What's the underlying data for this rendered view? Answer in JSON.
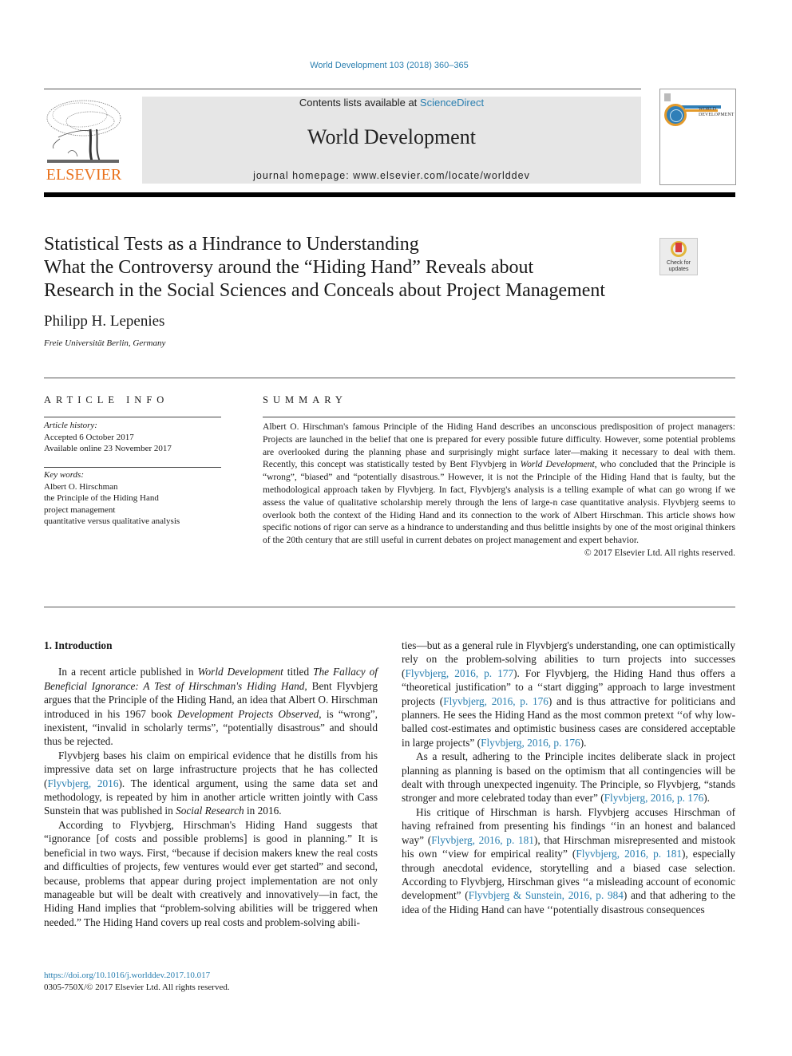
{
  "journal_reference": "World Development 103 (2018) 360–365",
  "masthead": {
    "contents_prefix": "Contents lists available at ",
    "contents_link": "ScienceDirect",
    "journal_title": "World Development",
    "homepage": "journal homepage: www.elsevier.com/locate/worlddev",
    "publisher_logo_text": "ELSEVIER",
    "cover_title_line1": "WORLD",
    "cover_title_line2": "DEVELOPMENT"
  },
  "colors": {
    "link": "#2a7fb0",
    "elsevier_orange": "#e9711c",
    "masthead_bg": "#e6e6e6"
  },
  "article": {
    "title_lines": [
      "Statistical Tests as a Hindrance to Understanding",
      "What the Controversy around the “Hiding Hand” Reveals about",
      "Research in the Social Sciences and Conceals about Project Management"
    ],
    "check_updates_label_1": "Check for",
    "check_updates_label_2": "updates",
    "author": "Philipp H. Lepenies",
    "affiliation": "Freie Universität Berlin, Germany"
  },
  "article_info": {
    "heading": "ARTICLE INFO",
    "history_label": "Article history:",
    "accepted": "Accepted 6 October 2017",
    "available_online": "Available online 23 November 2017",
    "keywords_label": "Key words:",
    "keywords": [
      "Albert O. Hirschman",
      "the Principle of the Hiding Hand",
      "project management",
      "quantitative versus qualitative analysis"
    ]
  },
  "summary": {
    "heading": "SUMMARY",
    "text_part1": "Albert O. Hirschman's famous Principle of the Hiding Hand describes an unconscious predisposition of project managers: Projects are launched in the belief that one is prepared for every possible future difficulty. However, some potential problems are overlooked during the planning phase and surprisingly might surface later—making it necessary to deal with them. Recently, this concept was statistically tested by Bent Flyvbjerg in ",
    "text_italic": "World Development",
    "text_part2": ", who concluded that the Principle is “wrong”, “biased” and “potentially disastrous.” However, it is not the Principle of the Hiding Hand that is faulty, but the methodological approach taken by Flyvbjerg. In fact, Flyvbjerg's analysis is a telling example of what can go wrong if we assess the value of qualitative scholarship merely through the lens of large-n case quantitative analysis. Flyvbjerg seems to overlook both the context of the Hiding Hand and its connection to the work of Albert Hirschman. This article shows how specific notions of rigor can serve as a hindrance to understanding and thus belittle insights by one of the most original thinkers of the 20th century that are still useful in current debates on project management and expert behavior.",
    "copyright": "© 2017 Elsevier Ltd. All rights reserved."
  },
  "body": {
    "section_heading": "1. Introduction",
    "p1": {
      "a": "In a recent article published in ",
      "b_italic": "World Development",
      "c": " titled ",
      "d_italic": "The Fallacy of Beneficial Ignorance: A Test of Hirschman's Hiding Hand,",
      "e": " Bent Flyvbjerg argues that the Principle of the Hiding Hand, an idea that Albert O. Hirschman introduced in his 1967 book ",
      "f_italic": "Development Projects Observed",
      "g": ", is “wrong”, inexistent, “invalid in scholarly terms”, “potentially disastrous” and should thus be rejected."
    },
    "p2": {
      "a": "Flyvbjerg bases his claim on empirical evidence that he distills from his impressive data set on large infrastructure projects that he has collected (",
      "cite1": "Flyvbjerg, 2016",
      "b": "). The identical argument, using the same data set and methodology, is repeated by him in another article written jointly with Cass Sunstein that was published in ",
      "c_italic": "Social Research",
      "d": " in 2016."
    },
    "p3": {
      "a": "According to Flyvbjerg, Hirschman's Hiding Hand suggests that “ignorance [of costs and possible problems] is good in planning.” It is beneficial in two ways. First, “because if decision makers knew the real costs and difficulties of projects, few ventures would ever get started” and second, because, problems that appear during project implementation are not only manageable but will be dealt with creatively and innovatively—in fact, the Hiding Hand implies that “problem-solving abilities will be triggered when needed.” The Hiding Hand covers up real costs and problem-solving abilities—but as a general rule in Flyvbjerg's understanding, one can optimistically rely on the problem-solving abilities to turn projects into successes (",
      "cite1": "Flyvbjerg, 2016, p. 177",
      "b": "). For Flyvbjerg, the Hiding Hand thus offers a “theoretical justification” to a ‘‘start digging” approach to large investment projects (",
      "cite2": "Flyvbjerg, 2016, p. 176",
      "c": ") and is thus attractive for politicians and planners. He sees the Hiding Hand as the most common pretext ‘‘of why low-balled cost-estimates and optimistic business cases are considered acceptable in large projects” (",
      "cite3": "Flyvbjerg, 2016, p. 176",
      "d": ")."
    },
    "p4": {
      "a": "As a result, adhering to the Principle incites deliberate slack in project planning as planning is based on the optimism that all contingencies will be dealt with through unexpected ingenuity. The Principle, so Flyvbjerg, “stands stronger and more celebrated today than ever” (",
      "cite1": "Flyvbjerg, 2016, p. 176",
      "b": ")."
    },
    "p5": {
      "a": "His critique of Hirschman is harsh. Flyvbjerg accuses Hirschman of having refrained from presenting his findings ‘‘in an honest and balanced way” (",
      "cite1": "Flyvbjerg, 2016, p. 181",
      "b": "), that Hirschman misrepresented and mistook his own ‘‘view for empirical reality” (",
      "cite2": "Flyvbjerg, 2016, p. 181",
      "c": "), especially through anecdotal evidence, storytelling and a biased case selection. According to Flyvbjerg, Hirschman gives ‘‘a misleading account of economic development” (",
      "cite3": "Flyvbjerg & Sunstein, 2016, p. 984",
      "d": ") and that adhering to the idea of the Hiding Hand can have ‘‘potentially disastrous consequences"
    }
  },
  "footer": {
    "doi": "https://doi.org/10.1016/j.worlddev.2017.10.017",
    "issn_copyright": "0305-750X/© 2017 Elsevier Ltd. All rights reserved."
  }
}
